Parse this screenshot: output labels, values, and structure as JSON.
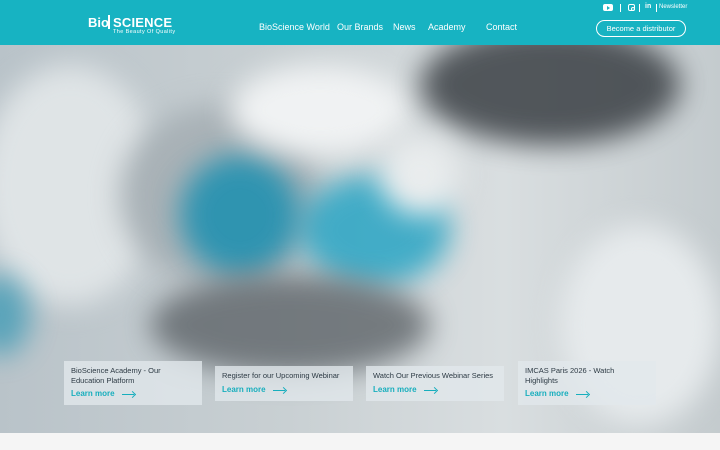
{
  "logo": {
    "bio": "Bio",
    "science": "SCIENCE",
    "tagline": "The Beauty Of Quality"
  },
  "nav": [
    {
      "label": "BioScience World"
    },
    {
      "label": "Our Brands"
    },
    {
      "label": "News"
    },
    {
      "label": "Academy"
    },
    {
      "label": "Contact"
    }
  ],
  "top_util": {
    "newsletter": "Newsletter",
    "linkedin": "in",
    "icons": [
      "youtube-icon",
      "instagram-icon",
      "linkedin-icon"
    ]
  },
  "cta": {
    "distributor": "Become a distributor"
  },
  "cards": [
    {
      "title": "BioScience Academy - Our Education Platform",
      "link": "Learn more"
    },
    {
      "title": "Register for our Upcoming Webinar",
      "link": "Learn more"
    },
    {
      "title": "Watch Our Previous Webinar Series",
      "link": "Learn more"
    },
    {
      "title": "IMCAS Paris 2026 - Watch Highlights",
      "link": "Learn more"
    }
  ],
  "colors": {
    "brand": "#17b3c2",
    "link": "#17aebd",
    "hero_accent": "#1a8fb0"
  }
}
